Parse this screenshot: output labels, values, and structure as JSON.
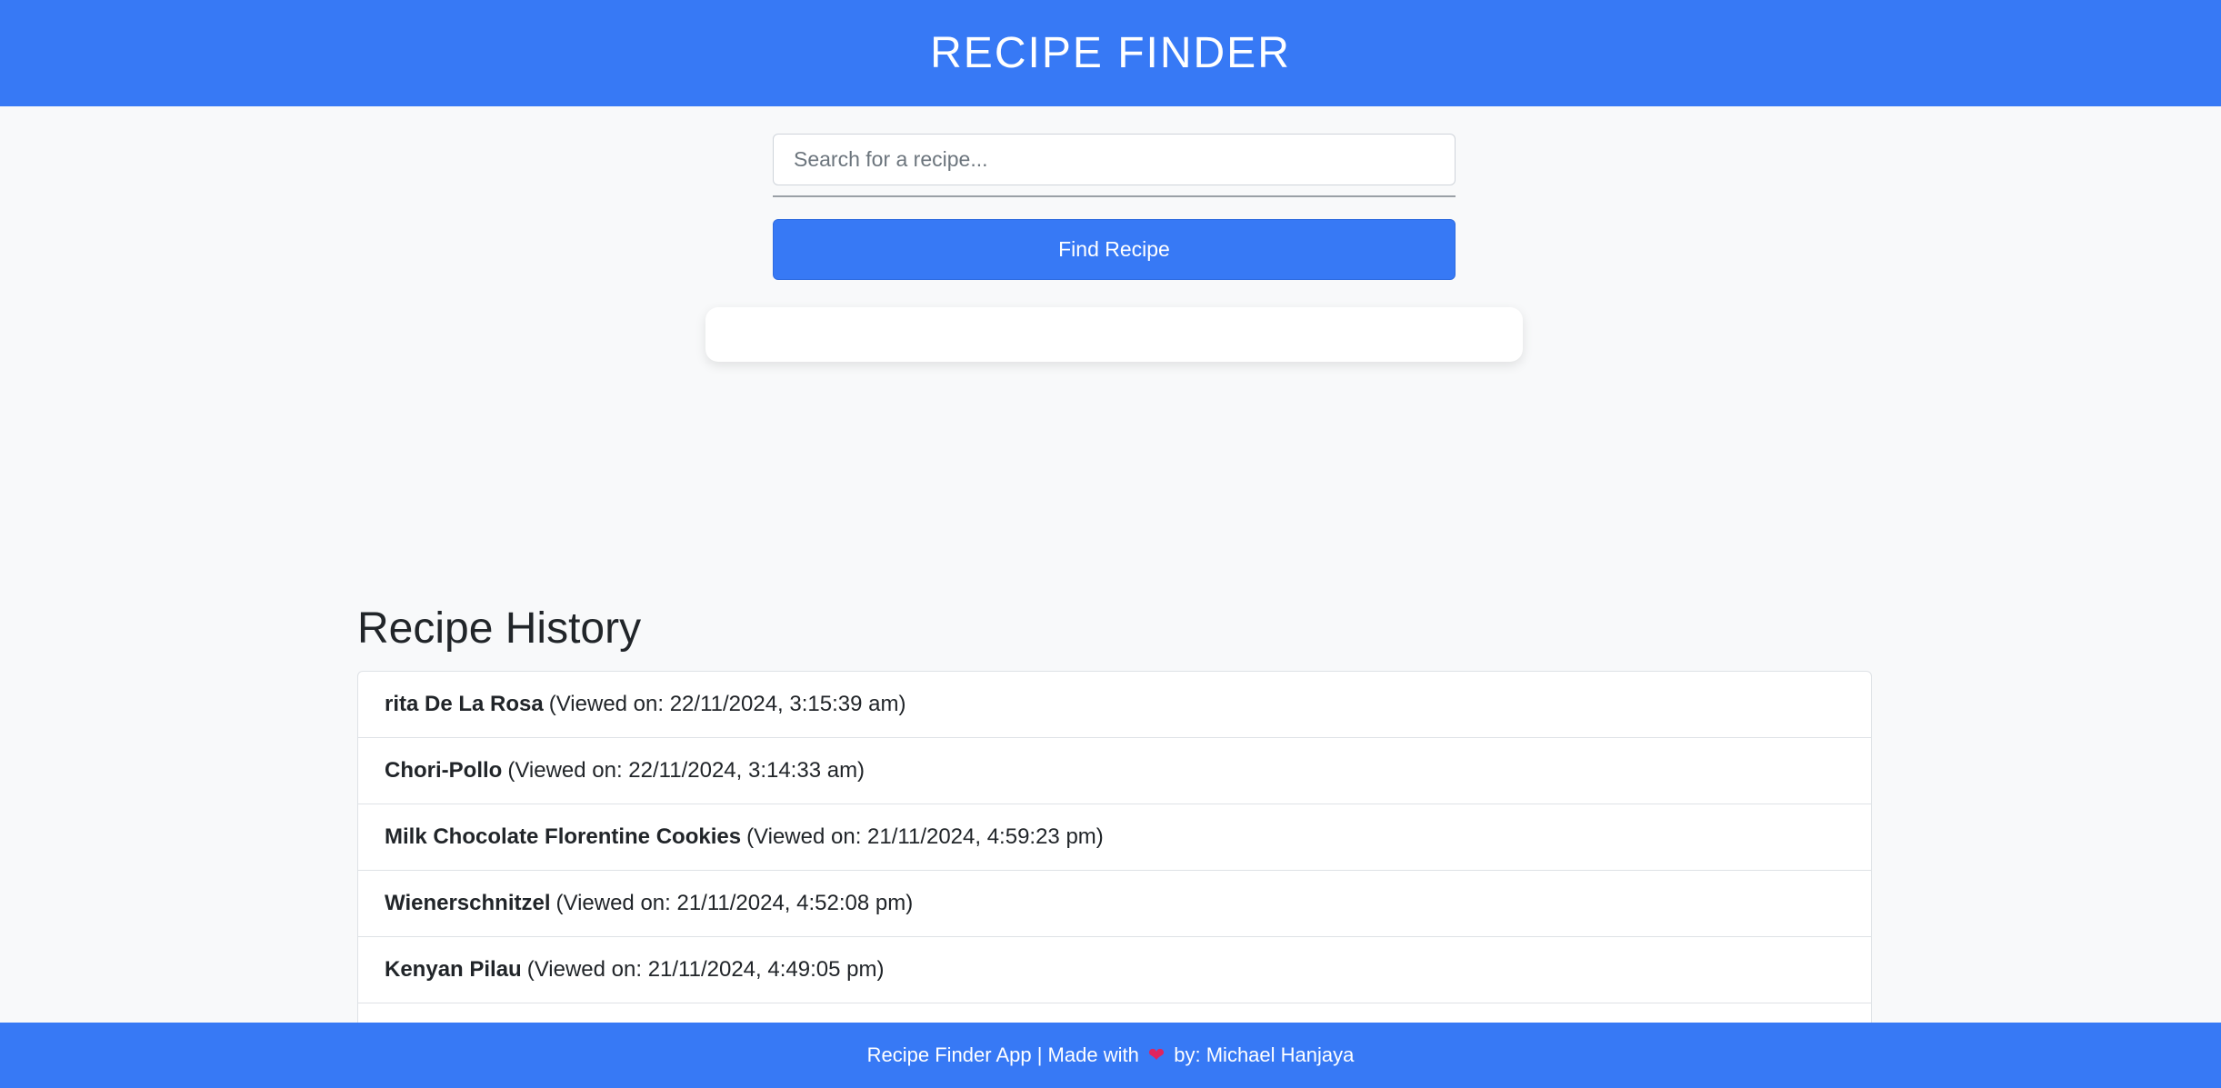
{
  "header": {
    "title": "RECIPE FINDER"
  },
  "search": {
    "placeholder": "Search for a recipe...",
    "value": "",
    "button_label": "Find Recipe"
  },
  "history": {
    "title": "Recipe History",
    "items": [
      {
        "name": "rita De La Rosa",
        "viewed": "(Viewed on: 22/11/2024, 3:15:39 am)"
      },
      {
        "name": "Chori-Pollo",
        "viewed": "(Viewed on: 22/11/2024, 3:14:33 am)"
      },
      {
        "name": "Milk Chocolate Florentine Cookies",
        "viewed": "(Viewed on: 21/11/2024, 4:59:23 pm)"
      },
      {
        "name": "Wienerschnitzel",
        "viewed": "(Viewed on: 21/11/2024, 4:52:08 pm)"
      },
      {
        "name": "Kenyan Pilau",
        "viewed": "(Viewed on: 21/11/2024, 4:49:05 pm)"
      }
    ]
  },
  "footer": {
    "text_before": "Recipe Finder App | Made with",
    "heart_icon": "❤",
    "text_after": "by: Michael Hanjaya"
  },
  "colors": {
    "primary": "#3779f5",
    "background": "#f8f9fa",
    "heart": "#e0245e"
  }
}
